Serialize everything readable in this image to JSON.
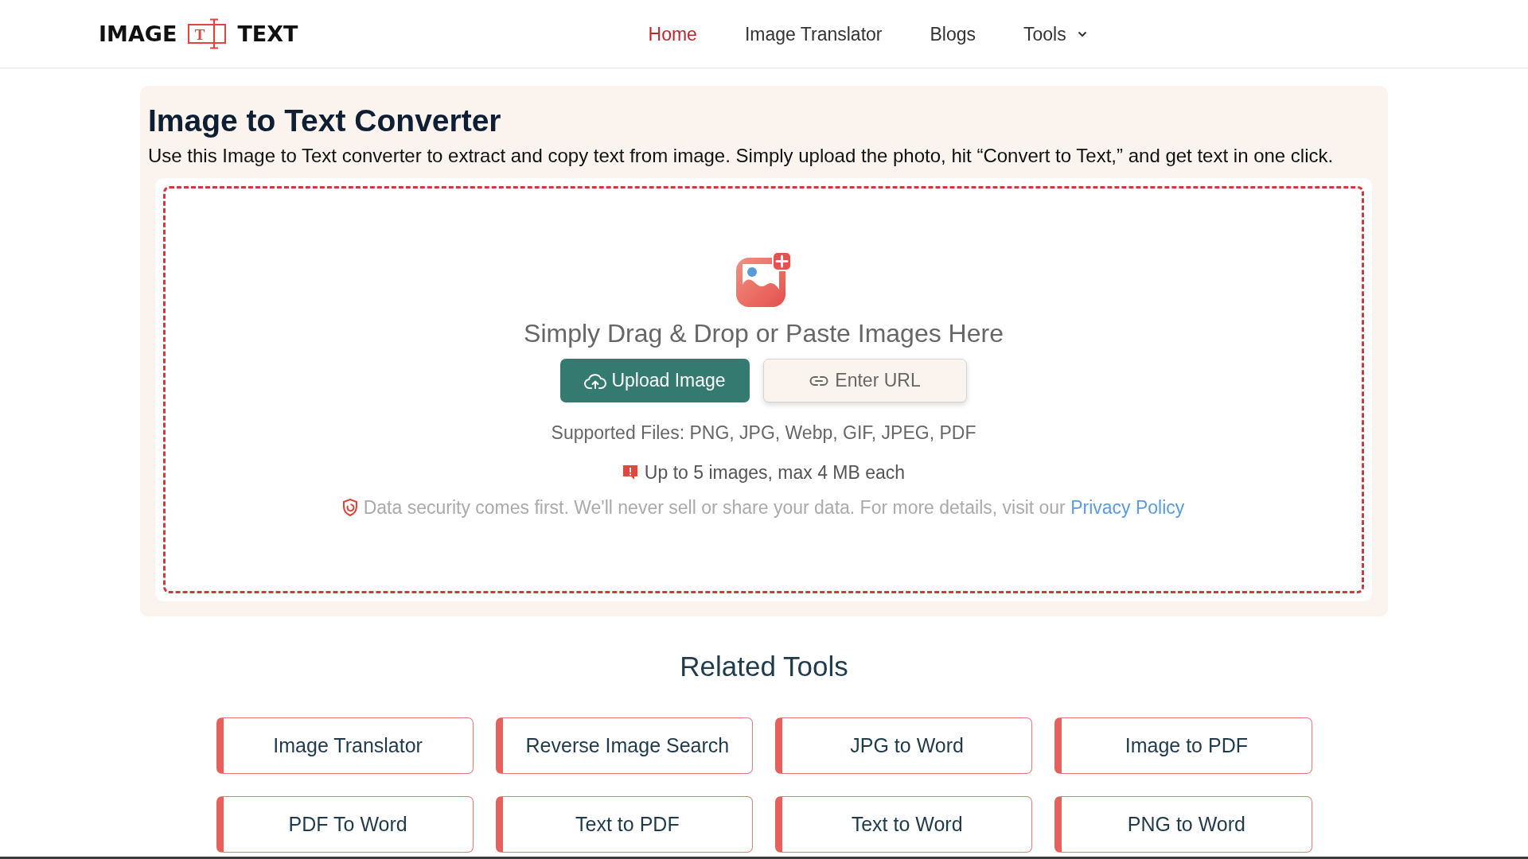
{
  "header": {
    "logo": {
      "left_text": "IMAGE",
      "icon_letter": "T",
      "right_text": "TEXT"
    },
    "nav": [
      {
        "label": "Home",
        "selected": true,
        "kind": "link"
      },
      {
        "label": "Image Translator",
        "selected": false,
        "kind": "link"
      },
      {
        "label": "Blogs",
        "selected": false,
        "kind": "link"
      },
      {
        "label": "Tools",
        "selected": false,
        "kind": "dropdown"
      }
    ]
  },
  "converter": {
    "title": "Image to Text Converter",
    "description": "Use this Image to Text converter to extract and copy text from image. Simply upload the photo, hit “Convert to Text,” and get text in one click.",
    "drop_zone": {
      "prompt": "Simply Drag & Drop or Paste Images Here",
      "buttons": [
        {
          "label": "Upload Image",
          "kind": "upload"
        },
        {
          "label": "Enter URL",
          "kind": "url"
        }
      ],
      "supported_files": "Supported Files: PNG, JPG, Webp, GIF, JPEG, PDF",
      "limit": "Up to 5 images, max 4 MB each",
      "privacy": {
        "text": "Data security comes first. We'll never sell or share your data. For more details, visit our",
        "link": "Privacy Policy"
      }
    }
  },
  "related_tools": {
    "title": "Related Tools",
    "items": [
      "Image Translator",
      "Reverse Image Search",
      "JPG to Word",
      "Image to PDF",
      "PDF To Word",
      "Text to PDF",
      "Text to Word",
      "PNG to Word"
    ]
  }
}
